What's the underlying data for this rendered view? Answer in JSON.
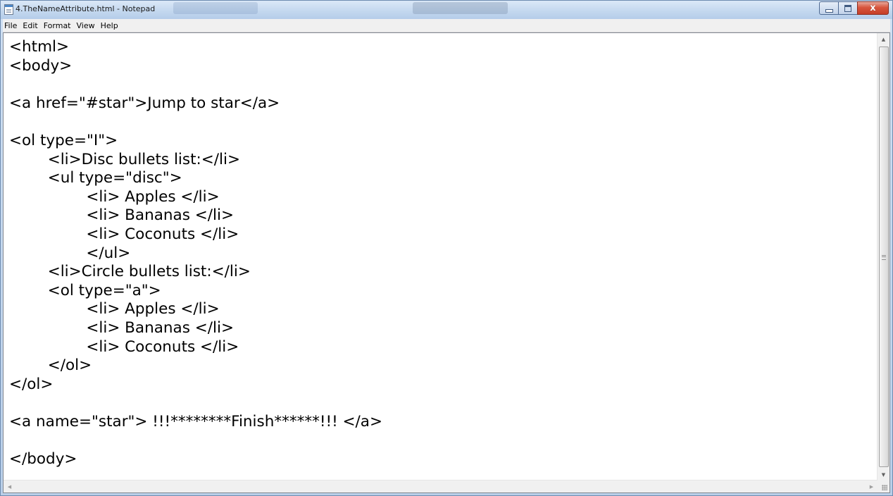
{
  "window": {
    "title": "4.TheNameAttribute.html - Notepad",
    "controls": {
      "minimize_icon": "minimize-icon",
      "maximize_icon": "maximize-icon",
      "close_icon": "close-icon",
      "close_glyph": "x"
    }
  },
  "menu": {
    "file": "File",
    "edit": "Edit",
    "format": "Format",
    "view": "View",
    "help": "Help"
  },
  "editor": {
    "lines": [
      "<html>",
      "<body>",
      "",
      "<a href=\"#star\">Jump to star</a>",
      "",
      "<ol type=\"I\">",
      "\t<li>Disc bullets list:</li>",
      "\t<ul type=\"disc\">",
      "\t\t<li> Apples </li>",
      "\t\t<li> Bananas </li>",
      "\t\t<li> Coconuts </li>",
      "\t\t</ul>",
      "\t<li>Circle bullets list:</li>",
      "\t<ol type=\"a\">",
      "\t\t<li> Apples </li>",
      "\t\t<li> Bananas </li>",
      "\t\t<li> Coconuts </li>",
      "\t</ol>",
      "</ol>",
      "",
      "<a name=\"star\"> !!!********Finish******!!! </a>",
      "",
      "</body>"
    ]
  },
  "scrollbars": {
    "up_arrow": "▲",
    "down_arrow": "▼",
    "left_arrow": "◀",
    "right_arrow": "▶"
  },
  "colors": {
    "title_bar": "#c4d8ef",
    "close_button": "#c63f28",
    "editor_bg": "#ffffff",
    "text": "#000000"
  }
}
